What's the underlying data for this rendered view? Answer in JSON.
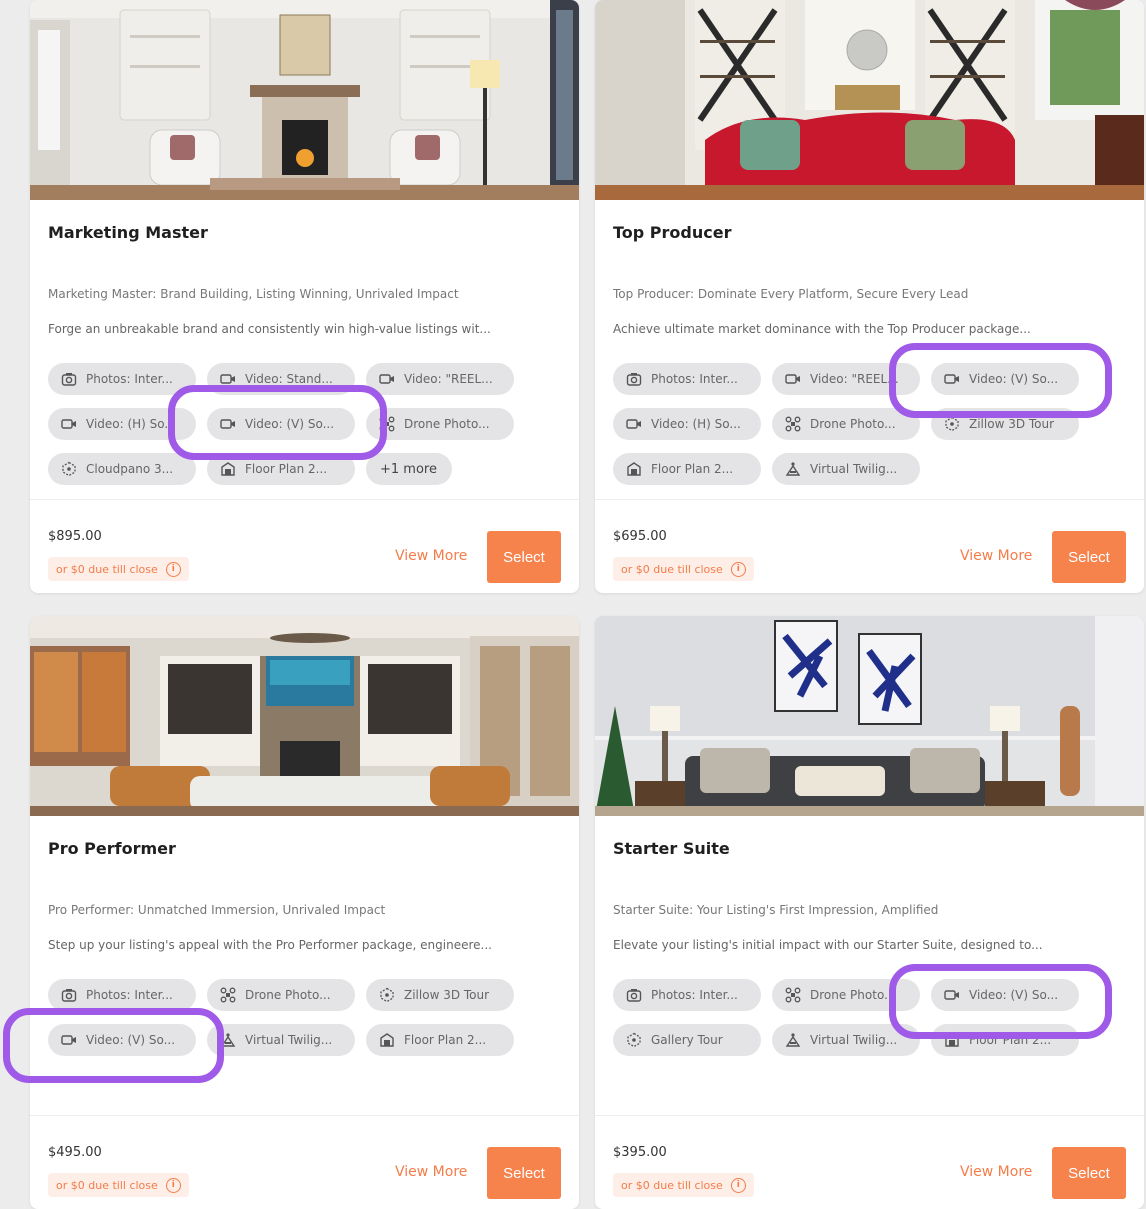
{
  "accent_color": "#f6824c",
  "highlight_color": "#a05ae8",
  "packages": [
    {
      "name": "Marketing Master",
      "tagline": "Marketing Master: Brand Building, Listing Winning, Unrivaled Impact",
      "description": "Forge an unbreakable brand and consistently win high-value listings wit...",
      "features": [
        {
          "icon": "camera-icon",
          "label": "Photos: Inter..."
        },
        {
          "icon": "video-icon",
          "label": "Video: Stand..."
        },
        {
          "icon": "video-icon",
          "label": "Video: \"REEL..."
        },
        {
          "icon": "video-icon",
          "label": "Video: (H) So..."
        },
        {
          "icon": "video-icon",
          "label": "Video: (V) So..."
        },
        {
          "icon": "drone-icon",
          "label": "Drone Photo..."
        },
        {
          "icon": "cube-icon",
          "label": "Cloudpano 3..."
        },
        {
          "icon": "floorplan-icon",
          "label": "Floor Plan 2..."
        }
      ],
      "more_label": "+1 more",
      "price": "$895.00",
      "due_text": "or $0 due till close",
      "view_more": "View More",
      "select": "Select"
    },
    {
      "name": "Top Producer",
      "tagline": "Top Producer: Dominate Every Platform, Secure Every Lead",
      "description": "Achieve ultimate market dominance with the Top Producer package...",
      "features": [
        {
          "icon": "camera-icon",
          "label": "Photos: Inter..."
        },
        {
          "icon": "video-icon",
          "label": "Video: \"REEL..."
        },
        {
          "icon": "video-icon",
          "label": "Video: (V) So..."
        },
        {
          "icon": "video-icon",
          "label": "Video: (H) So..."
        },
        {
          "icon": "drone-icon",
          "label": "Drone Photo..."
        },
        {
          "icon": "cube-icon",
          "label": "Zillow 3D Tour"
        },
        {
          "icon": "floorplan-icon",
          "label": "Floor Plan 2..."
        },
        {
          "icon": "twilight-icon",
          "label": "Virtual Twilig..."
        }
      ],
      "more_label": "",
      "price": "$695.00",
      "due_text": "or $0 due till close",
      "view_more": "View More",
      "select": "Select"
    },
    {
      "name": "Pro Performer",
      "tagline": "Pro Performer: Unmatched Immersion, Unrivaled Impact",
      "description": "Step up your listing's appeal with the Pro Performer package, engineere...",
      "features": [
        {
          "icon": "camera-icon",
          "label": "Photos: Inter..."
        },
        {
          "icon": "drone-icon",
          "label": "Drone Photo..."
        },
        {
          "icon": "cube-icon",
          "label": "Zillow 3D Tour"
        },
        {
          "icon": "video-icon",
          "label": "Video: (V) So..."
        },
        {
          "icon": "twilight-icon",
          "label": "Virtual Twilig..."
        },
        {
          "icon": "floorplan-icon",
          "label": "Floor Plan 2..."
        }
      ],
      "more_label": "",
      "price": "$495.00",
      "due_text": "or $0 due till close",
      "view_more": "View More",
      "select": "Select"
    },
    {
      "name": "Starter Suite",
      "tagline": "Starter Suite: Your Listing's First Impression, Amplified",
      "description": "Elevate your listing's initial impact with our Starter Suite, designed to...",
      "features": [
        {
          "icon": "camera-icon",
          "label": "Photos: Inter..."
        },
        {
          "icon": "drone-icon",
          "label": "Drone Photo..."
        },
        {
          "icon": "video-icon",
          "label": "Video: (V) So..."
        },
        {
          "icon": "cube-icon",
          "label": "Gallery Tour"
        },
        {
          "icon": "twilight-icon",
          "label": "Virtual Twilig..."
        },
        {
          "icon": "floorplan-icon",
          "label": "Floor Plan 2..."
        }
      ],
      "more_label": "",
      "price": "$395.00",
      "due_text": "or $0 due till close",
      "view_more": "View More",
      "select": "Select"
    }
  ]
}
